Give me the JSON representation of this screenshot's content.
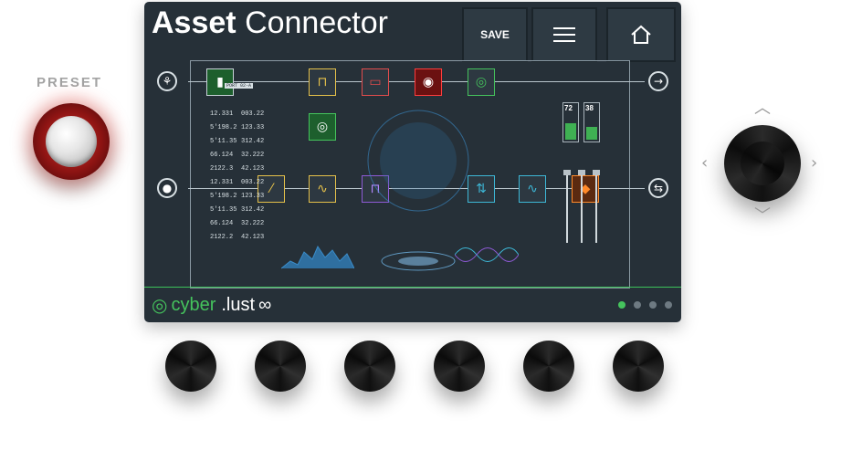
{
  "preset": {
    "label": "PRESET"
  },
  "header": {
    "title_bold": "Asset",
    "title_light": "Connector",
    "save_label": "SAVE",
    "menu_icon": "hamburger-menu-icon",
    "home_icon": "home-icon"
  },
  "graph": {
    "block_label": "PORT 02-A",
    "numbers_top": [
      "5'11.35",
      "12.331",
      "5'198.2",
      "5'11.35",
      "66.124",
      "2122.3",
      "12.331",
      "5'198.2",
      "5'11.35",
      "66.124",
      "2122.2"
    ],
    "numbers_mid": [
      "312.42",
      "003.22",
      "123.33",
      "312.42",
      "32.222",
      "42.123",
      "003.22",
      "123.33",
      "312.42",
      "32.222",
      "42.123"
    ],
    "meter_left": "72",
    "meter_right": "38",
    "inputs": {
      "top_left_icon": "guitar-icon",
      "bottom_left_icon": "microphone-icon",
      "top_right_icon": "arrow-right-icon",
      "bottom_right_icon": "usb-icon"
    },
    "meters_fill": [
      0.45,
      0.35
    ]
  },
  "footer": {
    "brand_left": "cyber",
    "brand_right": ".lust",
    "pages": 4,
    "active_page": 1
  },
  "colors": {
    "screen_bg": "#263038",
    "accent_green": "#45c35d",
    "preset_red": "#c42a26"
  }
}
